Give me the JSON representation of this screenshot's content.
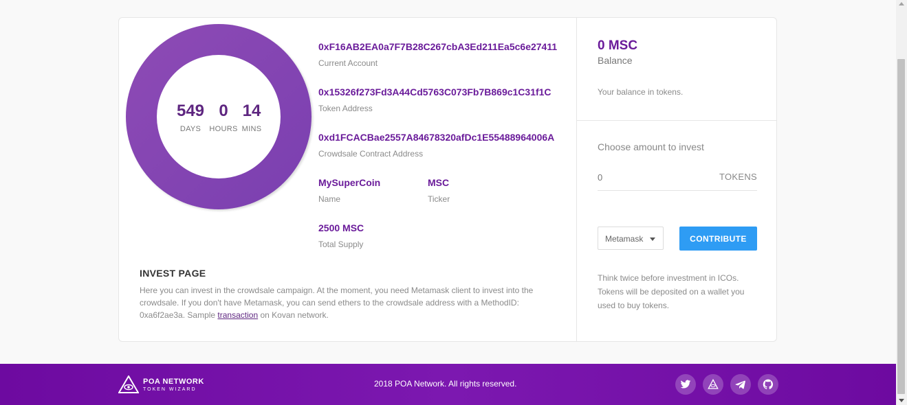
{
  "timer": {
    "days": "549",
    "days_label": "DAYS",
    "hours": "0",
    "hours_label": "HOURS",
    "mins": "14",
    "mins_label": "MINS"
  },
  "info": {
    "current_account": "0xF16AB2EA0a7F7B28C267cbA3Ed211Ea5c6e27411",
    "current_account_label": "Current Account",
    "token_address": "0x15326f273Fd3A44Cd5763C073Fb7B869c1C31f1C",
    "token_address_label": "Token Address",
    "crowdsale_address": "0xd1FCACBae2557A84678320afDc1E55488964006A",
    "crowdsale_address_label": "Crowdsale Contract Address",
    "name": "MySuperCoin",
    "name_label": "Name",
    "ticker": "MSC",
    "ticker_label": "Ticker",
    "total_supply": "2500 MSC",
    "total_supply_label": "Total Supply"
  },
  "invest": {
    "title": "INVEST PAGE",
    "desc_before": "Here you can invest in the crowdsale campaign. At the moment, you need Metamask client to invest into the crowdsale. If you don't have Metamask, you can send ethers to the crowdsale address with a MethodID: 0xa6f2ae3a. Sample ",
    "link_text": "transaction",
    "desc_after": " on Kovan network."
  },
  "balance": {
    "value": "0 MSC",
    "label": "Balance",
    "desc": "Your balance in tokens."
  },
  "contribute": {
    "choose_label": "Choose amount to invest",
    "amount_value": "0",
    "amount_unit": "TOKENS",
    "wallet_selected": "Metamask",
    "button_label": "CONTRIBUTE",
    "warning_line1": "Think twice before investment in ICOs.",
    "warning_line2": "Tokens will be deposited on a wallet you used to buy tokens."
  },
  "footer": {
    "logo_name": "POA NETWORK",
    "logo_sub": "TOKEN WIZARD",
    "copyright": "2018 POA Network. All rights reserved.",
    "social_icons": [
      "twitter-icon",
      "poa-icon",
      "telegram-icon",
      "github-icon"
    ]
  },
  "colors": {
    "accent": "#6a1b9a",
    "donut": "#8347b3",
    "button": "#2e9cf4",
    "footer": "#7010a8"
  }
}
